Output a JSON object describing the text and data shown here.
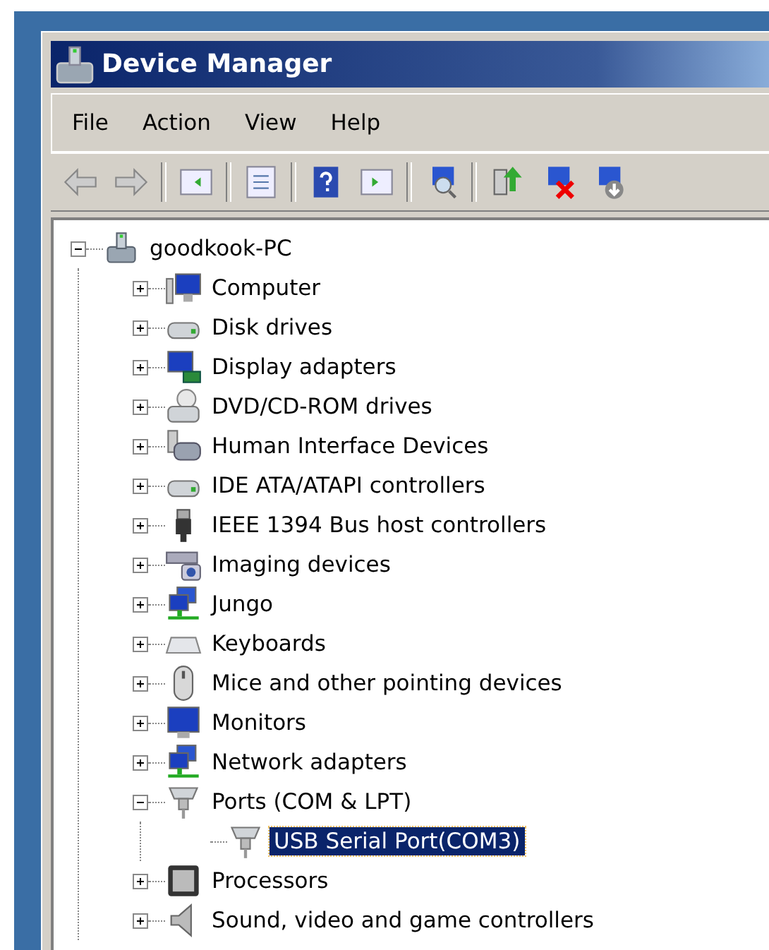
{
  "window": {
    "title": "Device Manager"
  },
  "menu": [
    {
      "label": "File"
    },
    {
      "label": "Action"
    },
    {
      "label": "View"
    },
    {
      "label": "Help"
    }
  ],
  "tree": {
    "label": "goodkook-PC",
    "kind": "pc",
    "expanded": true,
    "selected": false,
    "children": [
      {
        "label": "Computer",
        "kind": "computer",
        "expanded": false,
        "selected": false
      },
      {
        "label": "Disk drives",
        "kind": "disk",
        "expanded": false,
        "selected": false
      },
      {
        "label": "Display adapters",
        "kind": "display",
        "expanded": false,
        "selected": false
      },
      {
        "label": "DVD/CD-ROM drives",
        "kind": "dvd",
        "expanded": false,
        "selected": false
      },
      {
        "label": "Human Interface Devices",
        "kind": "hid",
        "expanded": false,
        "selected": false
      },
      {
        "label": "IDE ATA/ATAPI controllers",
        "kind": "disk",
        "expanded": false,
        "selected": false
      },
      {
        "label": "IEEE 1394 Bus host controllers",
        "kind": "plug",
        "expanded": false,
        "selected": false
      },
      {
        "label": "Imaging devices",
        "kind": "camera",
        "expanded": false,
        "selected": false
      },
      {
        "label": "Jungo",
        "kind": "network",
        "expanded": false,
        "selected": false
      },
      {
        "label": "Keyboards",
        "kind": "keyboard",
        "expanded": false,
        "selected": false
      },
      {
        "label": "Mice and other pointing devices",
        "kind": "mouse",
        "expanded": false,
        "selected": false
      },
      {
        "label": "Monitors",
        "kind": "monitor",
        "expanded": false,
        "selected": false
      },
      {
        "label": "Network adapters",
        "kind": "network",
        "expanded": false,
        "selected": false
      },
      {
        "label": "Ports (COM & LPT)",
        "kind": "port",
        "expanded": true,
        "selected": false,
        "children": [
          {
            "label": "USB Serial Port(COM3)",
            "kind": "port",
            "selected": true
          }
        ]
      },
      {
        "label": "Processors",
        "kind": "cpu",
        "expanded": false,
        "selected": false
      },
      {
        "label": "Sound, video and game controllers",
        "kind": "speaker",
        "expanded": false,
        "selected": false
      }
    ]
  }
}
